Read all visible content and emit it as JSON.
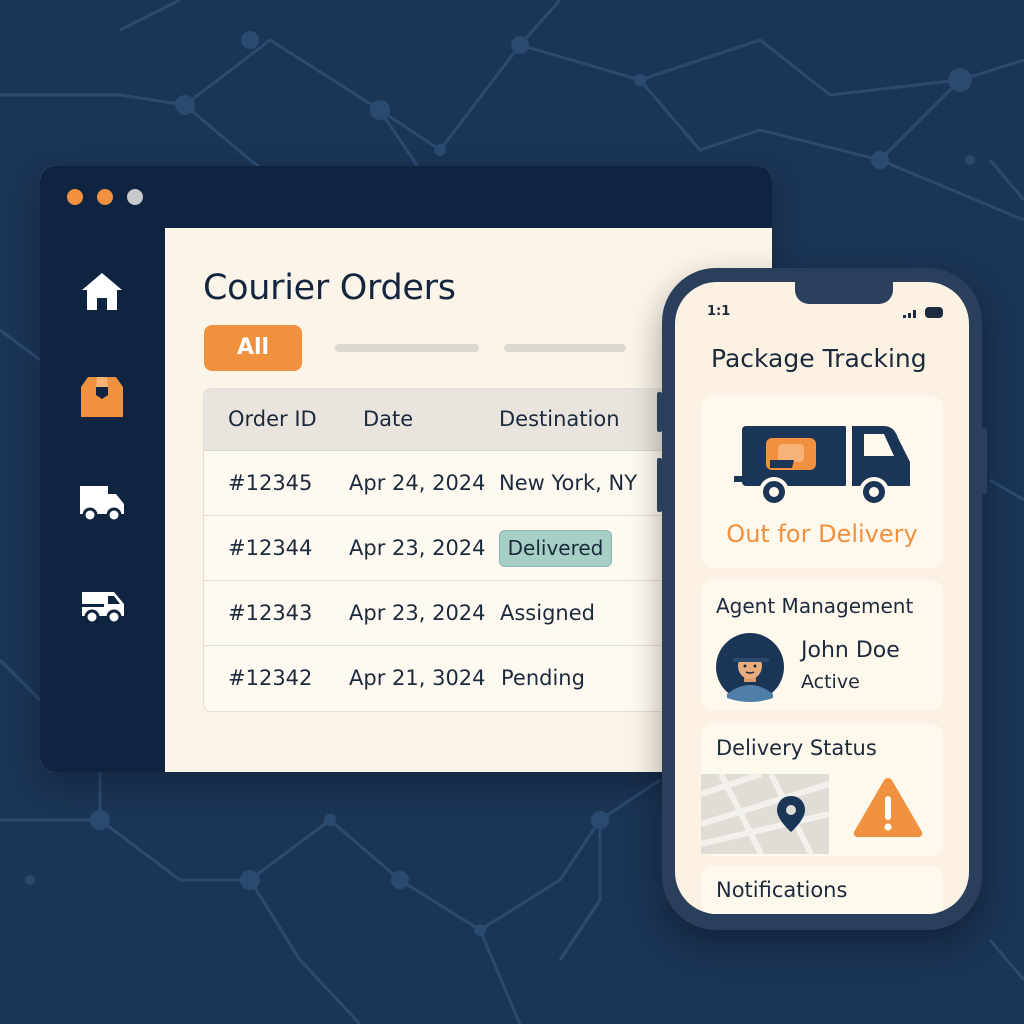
{
  "desktop": {
    "window_dots": [
      "orange-dot",
      "orange-dot",
      "gray-dot"
    ],
    "sidebar": {
      "items": [
        {
          "icon": "home-icon"
        },
        {
          "icon": "package-icon"
        },
        {
          "icon": "truck-icon"
        },
        {
          "icon": "van-icon"
        }
      ]
    },
    "page_title": "Courier Orders",
    "filter_tab_active": "All",
    "table": {
      "columns": [
        "Order ID",
        "Date",
        "Destination"
      ],
      "rows": [
        {
          "id": "#12345",
          "date": "Apr 24, 2024",
          "destination": "New York, NY"
        },
        {
          "id": "#12344",
          "date": "Apr 23, 2024",
          "destination": "Delivered"
        },
        {
          "id": "#12343",
          "date": "Apr 23, 2024",
          "destination": "Assigned"
        },
        {
          "id": "#12342",
          "date": "Apr 21, 3024",
          "destination": "Pending"
        }
      ]
    }
  },
  "phone": {
    "status_time": "1:1",
    "title": "Package Tracking",
    "tracking_status": "Out for Delivery",
    "agent_card": {
      "title": "Agent Management",
      "agent_name": "John Doe",
      "agent_status": "Active"
    },
    "delivery_card_title": "Delivery Status",
    "notifications_title": "Notifications"
  },
  "colors": {
    "background": "#1b3556",
    "navy": "#0f2440",
    "accent": "#f0913f",
    "surface": "#fbf4e8",
    "delivered_badge": "#a6cfc6"
  }
}
